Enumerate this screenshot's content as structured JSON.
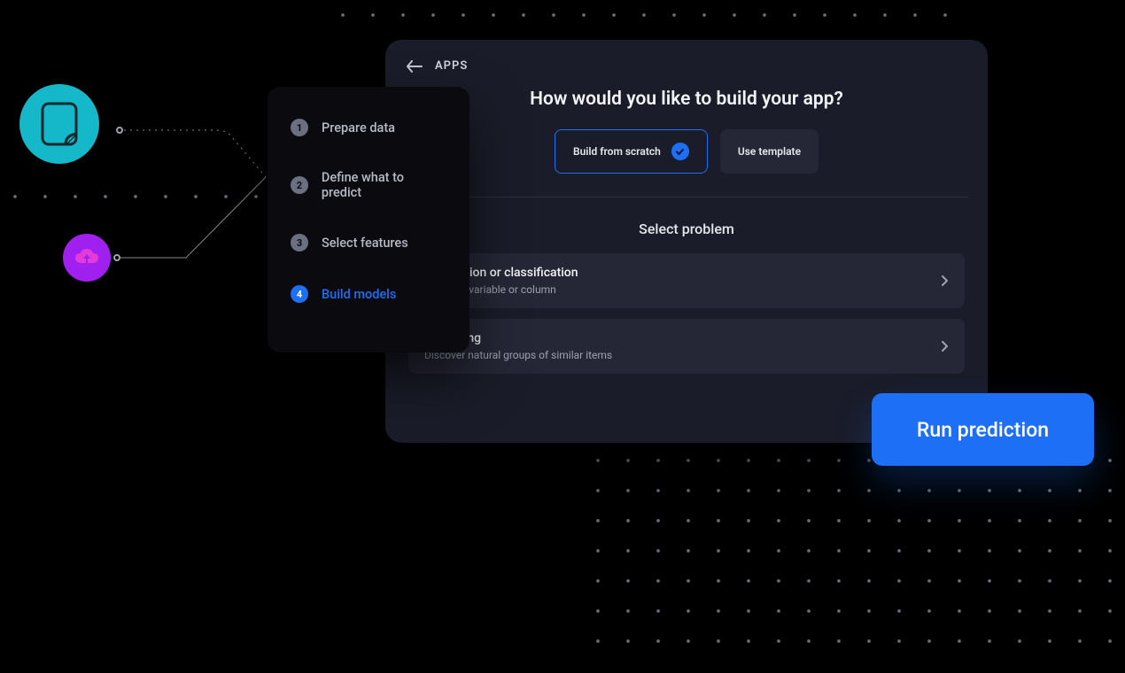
{
  "header": {
    "breadcrumb": "APPS",
    "title": "How would you like to build your app?"
  },
  "choices": {
    "build_scratch": "Build from scratch",
    "use_template": "Use template"
  },
  "section": {
    "title": "Select problem"
  },
  "problems": [
    {
      "title": "Regression or classification",
      "subtitle": "Predict a variable or column"
    },
    {
      "title": "Clustering",
      "subtitle": "Discover natural groups of similar items"
    }
  ],
  "stepper": [
    {
      "num": "1",
      "label": "Prepare data"
    },
    {
      "num": "2",
      "label": "Define what to predict"
    },
    {
      "num": "3",
      "label": "Select features"
    },
    {
      "num": "4",
      "label": "Build models"
    }
  ],
  "cta": {
    "run": "Run prediction"
  },
  "icons": {
    "file_disc": "file-icon",
    "cloud_disc": "cloud-upload-icon"
  },
  "colors": {
    "accent": "#1d6ff5",
    "cyan": "#14b8c9",
    "purple": "#a020f0",
    "panel": "#1a1c29",
    "card": "#252736"
  }
}
